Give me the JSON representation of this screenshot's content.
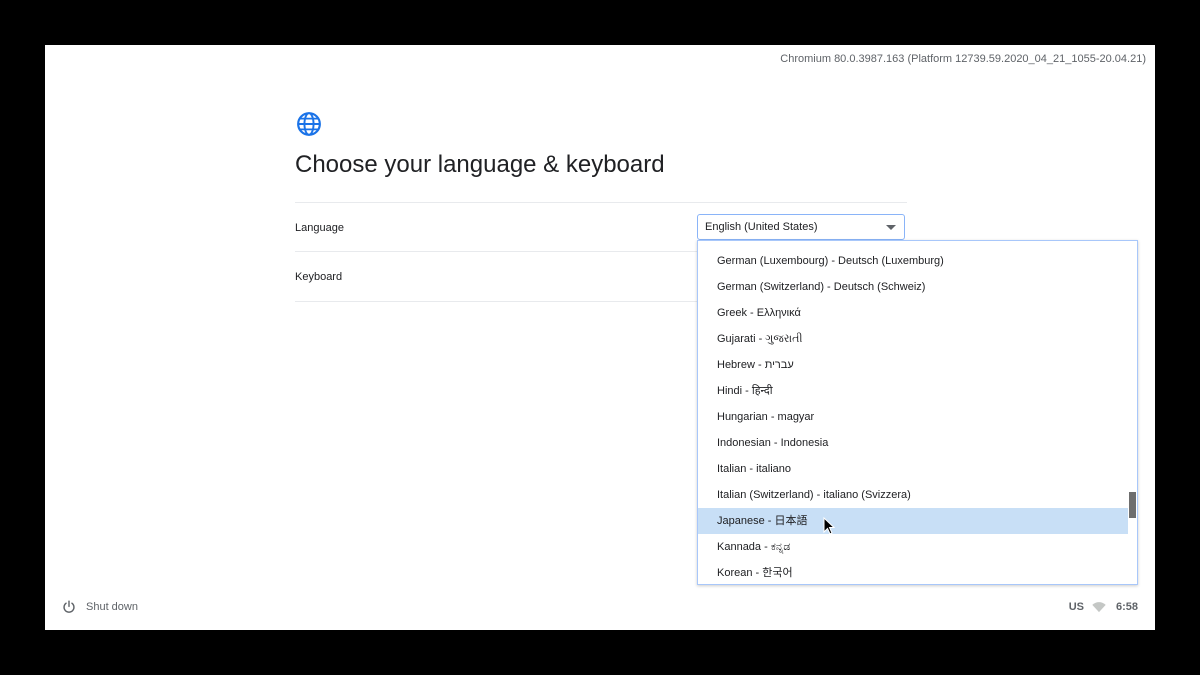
{
  "header": {
    "version": "Chromium 80.0.3987.163 (Platform 12739.59.2020_04_21_1055-20.04.21)"
  },
  "main": {
    "icon": "globe-icon",
    "title": "Choose your language & keyboard",
    "language_label": "Language",
    "keyboard_label": "Keyboard",
    "language_selected": "English (United States)"
  },
  "dropdown": {
    "options": [
      "German (Luxembourg) - Deutsch (Luxemburg)",
      "German (Switzerland) - Deutsch (Schweiz)",
      "Greek - Ελληνικά",
      "Gujarati - ગુજરાતી",
      "Hebrew - עברית",
      "Hindi - हिन्दी",
      "Hungarian - magyar",
      "Indonesian - Indonesia",
      "Italian - italiano",
      "Italian (Switzerland) - italiano (Svizzera)",
      "Japanese - 日本語",
      "Kannada - ಕನ್ನಡ",
      "Korean - 한국어"
    ],
    "highlighted": "Japanese - 日本語"
  },
  "footer": {
    "shutdown_label": "Shut down",
    "keyboard_layout": "US",
    "time": "6:58"
  },
  "colors": {
    "accent": "#1a73e8",
    "highlight": "#c8dff6"
  }
}
